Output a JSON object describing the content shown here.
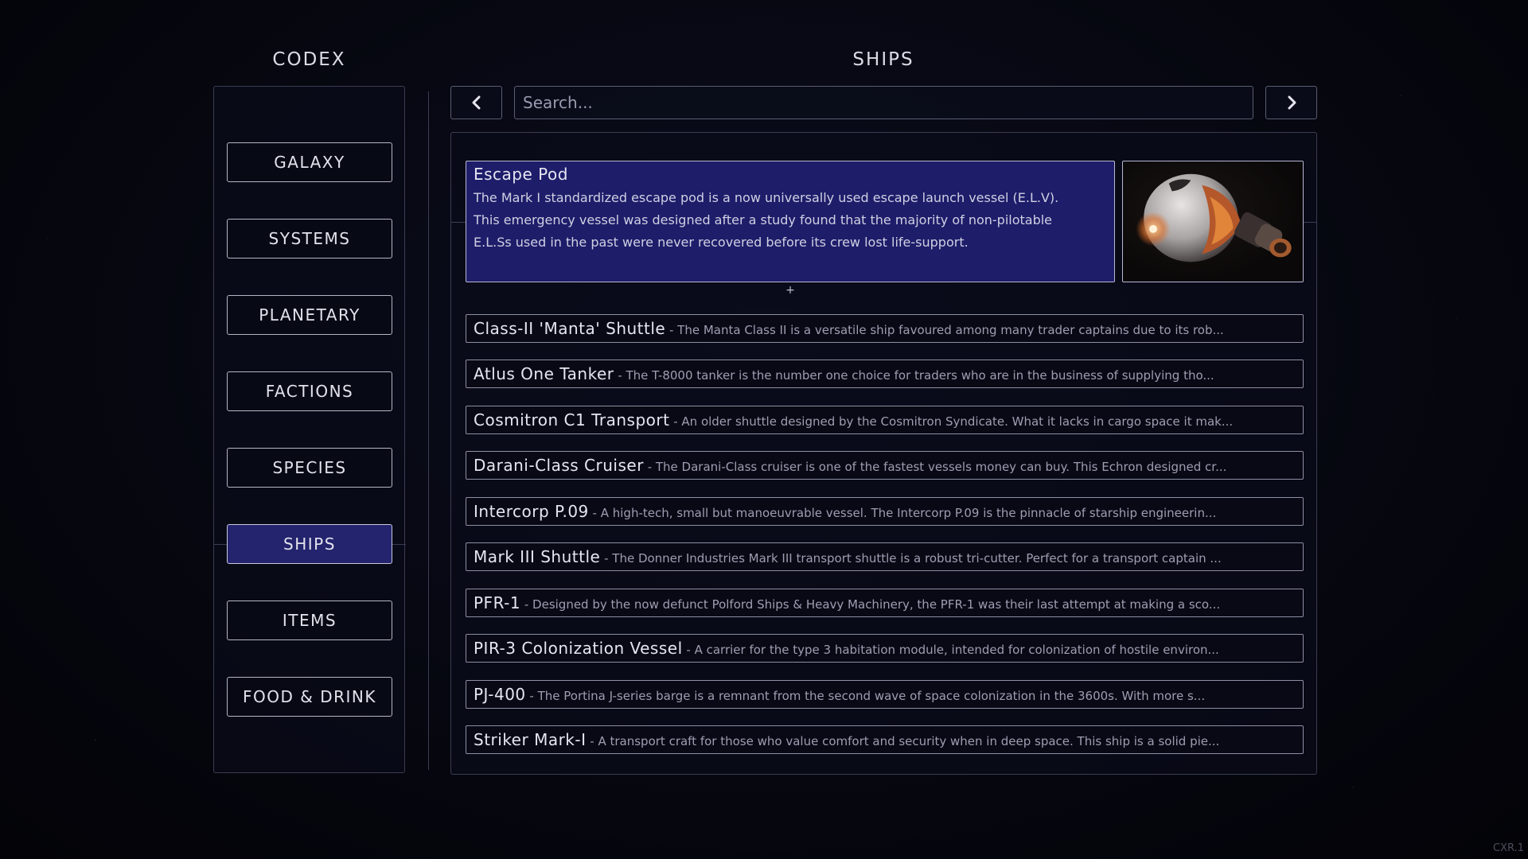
{
  "headings": {
    "codex": "CODEX",
    "ships": "SHIPS"
  },
  "sidebar": {
    "items": [
      {
        "label": "GALAXY"
      },
      {
        "label": "SYSTEMS"
      },
      {
        "label": "PLANETARY"
      },
      {
        "label": "FACTIONS"
      },
      {
        "label": "SPECIES"
      },
      {
        "label": "SHIPS",
        "active": true
      },
      {
        "label": "ITEMS"
      },
      {
        "label": "FOOD & DRINK"
      }
    ]
  },
  "search": {
    "placeholder": "Search..."
  },
  "featured": {
    "name": "Escape Pod",
    "desc_lines": [
      "The Mark I standardized escape pod is a now universally used escape launch vessel (E.L.V).",
      "This emergency vessel was designed after a study found that the majority of non-pilotable",
      "E.L.Ss used in the past were never recovered before its crew lost life-support."
    ],
    "expand": "+",
    "image_icon": "escape-pod-image"
  },
  "ships": [
    {
      "name": "Class-II 'Manta' Shuttle",
      "desc": " - The Manta Class II is a versatile ship favoured among many trader captains due to its rob..."
    },
    {
      "name": "Atlus One Tanker",
      "desc": " - The T-8000 tanker is the number one choice for traders who are in the business of supplying tho..."
    },
    {
      "name": "Cosmitron C1 Transport",
      "desc": " - An older shuttle designed by the Cosmitron Syndicate. What it lacks in cargo space it mak..."
    },
    {
      "name": "Darani-Class Cruiser",
      "desc": " - The Darani-Class cruiser is one of the fastest vessels money can buy. This Echron designed cr..."
    },
    {
      "name": "Intercorp P.09",
      "desc": " - A high-tech, small but manoeuvrable vessel. The Intercorp P.09 is the pinnacle of starship engineerin..."
    },
    {
      "name": "Mark III Shuttle",
      "desc": " - The Donner Industries Mark III transport shuttle is a robust tri-cutter. Perfect for a transport captain ..."
    },
    {
      "name": "PFR-1",
      "desc": " - Designed by the now defunct Polford Ships & Heavy Machinery, the PFR-1 was their last attempt at making a sco..."
    },
    {
      "name": "PIR-3 Colonization Vessel",
      "desc": " - A carrier for the type 3 habitation module, intended for colonization of hostile environ..."
    },
    {
      "name": "PJ-400",
      "desc": " - The Portina J-series barge is a remnant from the second wave of space colonization in the 3600s. With more s..."
    },
    {
      "name": "Striker Mark-I",
      "desc": " - A transport craft for those who value comfort and security when in deep space. This ship is a solid pie..."
    }
  ],
  "version": "CXR.1",
  "colors": {
    "active": "#23236e",
    "featured_bg": "#1e1d6a",
    "border": "#8d8fa4"
  }
}
